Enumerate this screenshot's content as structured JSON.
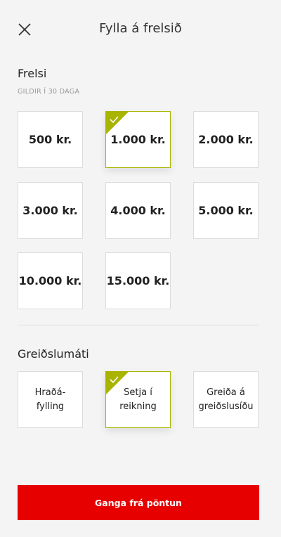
{
  "header": {
    "title": "Fylla á frelsið",
    "close_icon": "close-icon"
  },
  "frelsi": {
    "heading": "Frelsi",
    "validity": "GILDIR Í 30 DAGA",
    "amounts": [
      {
        "label": "500 kr.",
        "selected": false
      },
      {
        "label": "1.000 kr.",
        "selected": true
      },
      {
        "label": "2.000 kr.",
        "selected": false
      },
      {
        "label": "3.000 kr.",
        "selected": false
      },
      {
        "label": "4.000 kr.",
        "selected": false
      },
      {
        "label": "5.000 kr.",
        "selected": false
      },
      {
        "label": "10.000 kr.",
        "selected": false
      },
      {
        "label": "15.000 kr.",
        "selected": false
      }
    ]
  },
  "payment": {
    "heading": "Greiðslumáti",
    "methods": [
      {
        "label": "Hraðá-fylling",
        "selected": false
      },
      {
        "label": "Setja í reikning",
        "selected": true
      },
      {
        "label": "Greiða á greiðslusíðu",
        "selected": false
      }
    ]
  },
  "submit": {
    "label": "Ganga frá pöntun"
  },
  "colors": {
    "accent_selected": "#a8b400",
    "brand_red": "#e60000"
  }
}
